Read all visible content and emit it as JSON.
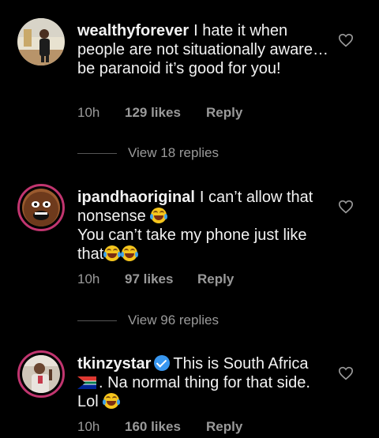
{
  "comments": [
    {
      "username": "wealthyforever",
      "text": "I hate it when people are not situationally aware… be paranoid it’s good for you!",
      "time": "10h",
      "likes": "129 likes",
      "reply": "Reply",
      "view_replies": "View 18 replies"
    },
    {
      "username": "ipandhaoriginal",
      "text_line1": "I can’t allow that nonsense",
      "text_line2": "You can’t take my phone just like that",
      "time": "10h",
      "likes": "97 likes",
      "reply": "Reply",
      "view_replies": "View 96 replies"
    },
    {
      "username": "tkinzystar",
      "verified": true,
      "text_part1": "This is South Africa",
      "text_part2": ". Na normal thing for that side. Lol",
      "time": "10h",
      "likes": "160 likes",
      "reply": "Reply"
    }
  ],
  "icons": {
    "like": "heart-outline-icon",
    "emoji": "face-with-tears-of-joy",
    "flag": "south-africa-flag",
    "verified": "verified-badge-icon"
  },
  "colors": {
    "background": "#000000",
    "text": "#f2f2f2",
    "meta": "#9a9a9a",
    "story_ring": "#c1356f",
    "verified": "#3897f0"
  }
}
